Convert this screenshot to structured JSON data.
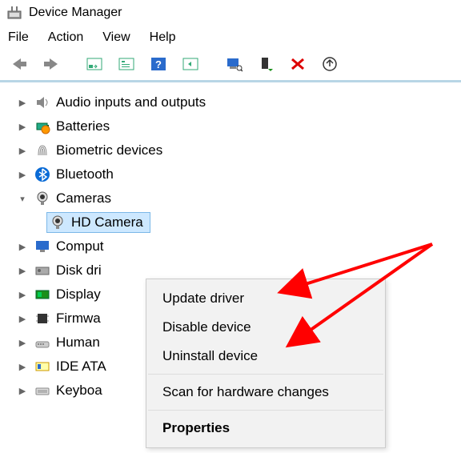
{
  "window": {
    "title": "Device Manager"
  },
  "menubar": {
    "file": "File",
    "action": "Action",
    "view": "View",
    "help": "Help"
  },
  "tree": {
    "items": [
      {
        "label": "Audio inputs and outputs",
        "icon": "speaker"
      },
      {
        "label": "Batteries",
        "icon": "battery"
      },
      {
        "label": "Biometric devices",
        "icon": "fingerprint"
      },
      {
        "label": "Bluetooth",
        "icon": "bluetooth"
      },
      {
        "label": "Cameras",
        "icon": "camera",
        "expanded": true,
        "children": [
          {
            "label": "HD Camera",
            "icon": "camera",
            "selected": true
          }
        ]
      },
      {
        "label": "Comput",
        "icon": "monitor"
      },
      {
        "label": "Disk dri",
        "icon": "disk"
      },
      {
        "label": "Display",
        "icon": "gpu"
      },
      {
        "label": "Firmwa",
        "icon": "chip"
      },
      {
        "label": "Human",
        "icon": "hid"
      },
      {
        "label": "IDE ATA",
        "icon": "ide"
      },
      {
        "label": "Keyboa",
        "icon": "keyboard"
      }
    ]
  },
  "context_menu": {
    "update": "Update driver",
    "disable": "Disable device",
    "uninstall": "Uninstall device",
    "scan": "Scan for hardware changes",
    "properties": "Properties"
  }
}
